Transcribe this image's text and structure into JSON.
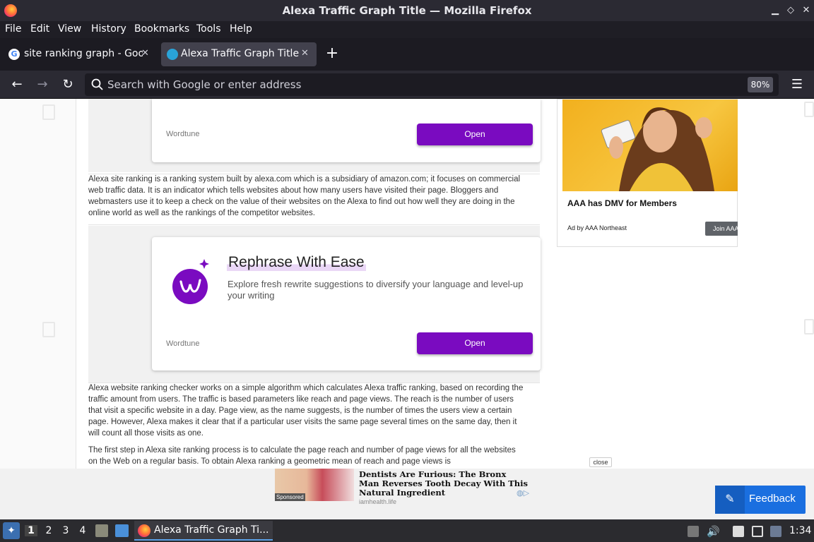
{
  "window": {
    "title": "Alexa Traffic Graph Title — Mozilla Firefox",
    "minimize": "▁",
    "maximize": "◇",
    "close": "✕"
  },
  "menu": [
    "File",
    "Edit",
    "View",
    "History",
    "Bookmarks",
    "Tools",
    "Help"
  ],
  "tabs": [
    {
      "label": "site ranking graph - Google",
      "active": false,
      "favicon": "google-icon"
    },
    {
      "label": "Alexa Traffic Graph Title",
      "active": true,
      "favicon": "site-icon"
    }
  ],
  "tab_close": "✕",
  "new_tab": "+",
  "nav": {
    "back": "←",
    "forward": "→",
    "reload": "↻",
    "url_placeholder": "Search with Google or enter address",
    "zoom": "80%",
    "menu": "☰"
  },
  "article": {
    "card1": {
      "brand": "Wordtune",
      "button": "Open"
    },
    "para1": "Alexa site ranking is a ranking system built by alexa.com which is a subsidiary of amazon.com; it focuses on commercial web traffic data. It is an indicator which tells websites about how many users have visited their page. Bloggers and webmasters use it to keep a check on the value of their websites on the Alexa to find out how well they are doing in the online world as well as the rankings of the competitor websites.",
    "card2": {
      "title": "Rephrase With Ease",
      "desc": "Explore fresh rewrite suggestions to diversify your language and level-up your writing",
      "brand": "Wordtune",
      "button": "Open"
    },
    "para2": "Alexa website ranking checker works on a simple algorithm which calculates Alexa traffic ranking, based on recording the traffic amount from users. The traffic is based parameters like reach and page views. The reach is the number of users that visit a specific website in a day. Page view, as the name suggests, is the number of times the users view a certain page. However, Alexa makes it clear that if a particular user visits the same page several times on the same day, then it will count all those visits as one.",
    "para3": "The first step in Alexa site ranking process is to calculate the page reach and number of page views for all the websites on the Web on a regular basis. To obtain Alexa ranking a geometric mean of reach and page views is"
  },
  "side_ad": {
    "headline": "AAA has DMV for Members",
    "by": "Ad by AAA Northeast",
    "button": "Join AAA"
  },
  "bottom_ad": {
    "close": "close",
    "sponsored": "Sponsored",
    "headline": "Dentists Are Furious: The Bronx Man Reverses Tooth Decay With This Natural Ingredient",
    "source": "iamhealth.life",
    "feedback": "Feedback"
  },
  "taskbar": {
    "workspaces": [
      "1",
      "2",
      "3",
      "4"
    ],
    "task": "Alexa Traffic Graph Ti...",
    "clock": "1:34"
  }
}
